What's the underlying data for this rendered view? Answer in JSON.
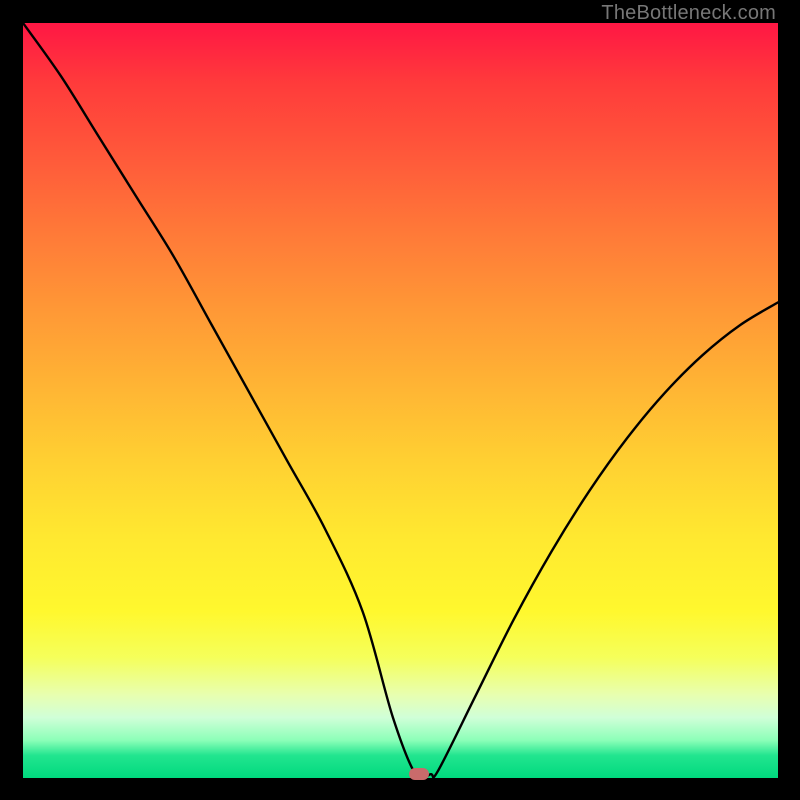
{
  "watermark": "TheBottleneck.com",
  "chart_data": {
    "type": "line",
    "title": "",
    "xlabel": "",
    "ylabel": "",
    "xlim": [
      0,
      100
    ],
    "ylim": [
      0,
      100
    ],
    "grid": false,
    "legend": false,
    "series": [
      {
        "name": "curve",
        "x": [
          0,
          5,
          10,
          15,
          20,
          25,
          30,
          35,
          40,
          45,
          49,
          52,
          54,
          55,
          60,
          65,
          70,
          75,
          80,
          85,
          90,
          95,
          100
        ],
        "y": [
          100,
          93,
          85,
          77,
          69,
          60,
          51,
          42,
          33,
          22,
          8,
          0.5,
          0.5,
          1,
          11,
          21,
          30,
          38,
          45,
          51,
          56,
          60,
          63
        ]
      }
    ],
    "marker": {
      "x": 52.5,
      "y": 0.5,
      "color": "#c96b6b"
    },
    "gradient_stops": [
      {
        "pos": 0,
        "color": "#ff1744"
      },
      {
        "pos": 50,
        "color": "#ffd032"
      },
      {
        "pos": 85,
        "color": "#f5ff5a"
      },
      {
        "pos": 100,
        "color": "#00d97e"
      }
    ]
  }
}
